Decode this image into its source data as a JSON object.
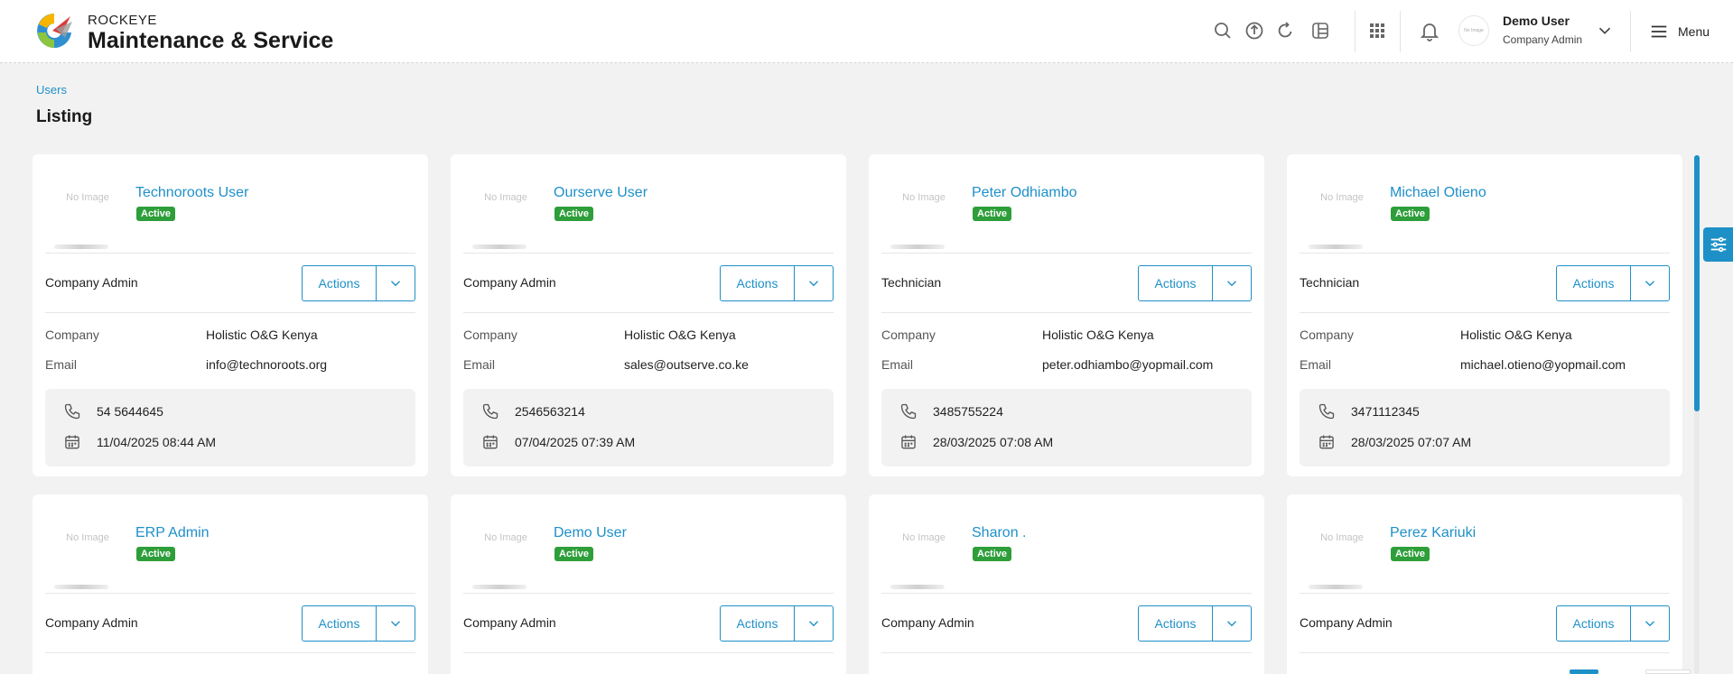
{
  "header": {
    "brand_top": "ROCKEYE",
    "brand_main": "Maintenance & Service",
    "user_name": "Demo User",
    "user_role": "Company Admin",
    "avatar_text": "No Image",
    "menu_label": "Menu"
  },
  "breadcrumb": {
    "item": "Users"
  },
  "page": {
    "title": "Listing"
  },
  "labels": {
    "actions": "Actions",
    "active": "Active",
    "company": "Company",
    "email": "Email",
    "no_image": "No Image"
  },
  "cards": [
    {
      "name": "Technoroots User",
      "status": "Active",
      "role": "Company Admin",
      "company": "Holistic O&G Kenya",
      "email": "info@technoroots.org",
      "phone": "54 5644645",
      "date": "11/04/2025 08:44 AM"
    },
    {
      "name": "Ourserve User",
      "status": "Active",
      "role": "Company Admin",
      "company": "Holistic O&G Kenya",
      "email": "sales@outserve.co.ke",
      "phone": "2546563214",
      "date": "07/04/2025 07:39 AM"
    },
    {
      "name": "Peter Odhiambo",
      "status": "Active",
      "role": "Technician",
      "company": "Holistic O&G Kenya",
      "email": "peter.odhiambo@yopmail.com",
      "phone": "3485755224",
      "date": "28/03/2025 07:08 AM"
    },
    {
      "name": "Michael Otieno",
      "status": "Active",
      "role": "Technician",
      "company": "Holistic O&G Kenya",
      "email": "michael.otieno@yopmail.com",
      "phone": "3471112345",
      "date": "28/03/2025 07:07 AM"
    },
    {
      "name": "ERP Admin",
      "status": "Active",
      "role": "Company Admin"
    },
    {
      "name": "Demo User",
      "status": "Active",
      "role": "Company Admin"
    },
    {
      "name": "Sharon .",
      "status": "Active",
      "role": "Company Admin"
    },
    {
      "name": "Perez Kariuki",
      "status": "Active",
      "role": "Company Admin"
    }
  ],
  "colors": {
    "accent": "#1e90c8",
    "active_badge": "#2e9e3a",
    "background": "#f2f2f2"
  }
}
